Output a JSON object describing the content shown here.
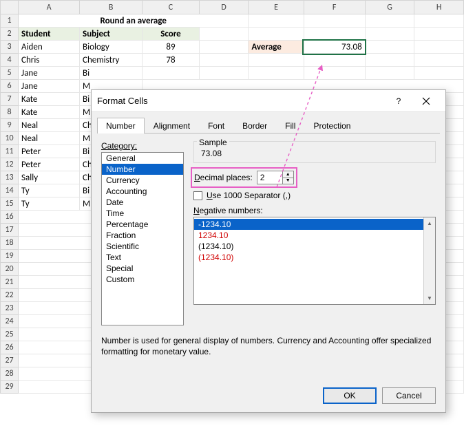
{
  "sheet": {
    "columns": [
      "A",
      "B",
      "C",
      "D",
      "E",
      "F",
      "G",
      "H"
    ],
    "title": "Round an average",
    "headers": {
      "a": "Student",
      "b": "Subject",
      "c": "Score"
    },
    "avg_label": "Average",
    "avg_value": "73.08",
    "rows": [
      {
        "student": "Aiden",
        "subject": "Biology",
        "score": "89"
      },
      {
        "student": "Chris",
        "subject": "Chemistry",
        "score": "78"
      },
      {
        "student": "Jane",
        "subject": "Bi",
        "score": ""
      },
      {
        "student": "Jane",
        "subject": "M",
        "score": ""
      },
      {
        "student": "Kate",
        "subject": "Bi",
        "score": ""
      },
      {
        "student": "Kate",
        "subject": "M",
        "score": ""
      },
      {
        "student": "Neal",
        "subject": "Ch",
        "score": ""
      },
      {
        "student": "Neal",
        "subject": "M",
        "score": ""
      },
      {
        "student": "Peter",
        "subject": "Bi",
        "score": ""
      },
      {
        "student": "Peter",
        "subject": "Ch",
        "score": ""
      },
      {
        "student": "Sally",
        "subject": "Ch",
        "score": ""
      },
      {
        "student": "Ty",
        "subject": "Bi",
        "score": ""
      },
      {
        "student": "Ty",
        "subject": "M",
        "score": ""
      }
    ],
    "row_numbers": [
      1,
      2,
      3,
      4,
      5,
      6,
      7,
      8,
      9,
      10,
      11,
      12,
      13,
      14,
      15,
      16,
      17,
      18,
      19,
      20,
      21,
      22,
      23,
      24,
      25,
      26,
      27,
      28,
      29
    ]
  },
  "dialog": {
    "title": "Format Cells",
    "help": "?",
    "tabs": [
      "Number",
      "Alignment",
      "Font",
      "Border",
      "Fill",
      "Protection"
    ],
    "category_label": "Category:",
    "categories": [
      "General",
      "Number",
      "Currency",
      "Accounting",
      "Date",
      "Time",
      "Percentage",
      "Fraction",
      "Scientific",
      "Text",
      "Special",
      "Custom"
    ],
    "selected_category": "Number",
    "sample_label": "Sample",
    "sample_value": "73.08",
    "decimal_label_pre": "",
    "decimal_label": "Decimal places:",
    "decimal_value": "2",
    "separator_label": "Use 1000 Separator (,)",
    "negative_label": "Negative numbers:",
    "negatives": [
      "-1234.10",
      "1234.10",
      "(1234.10)",
      "(1234.10)"
    ],
    "note": "Number is used for general display of numbers.  Currency and Accounting offer specialized formatting for monetary value.",
    "ok": "OK",
    "cancel": "Cancel"
  }
}
